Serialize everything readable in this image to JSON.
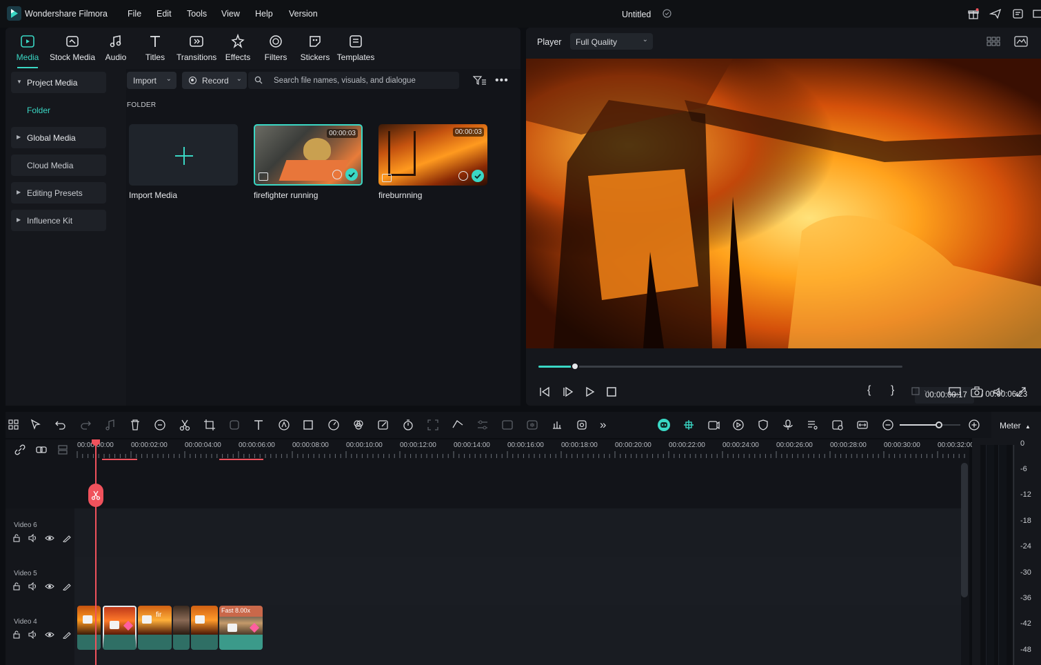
{
  "titlebar": {
    "app_name": "Wondershare Filmora",
    "menu": [
      "File",
      "Edit",
      "Tools",
      "View",
      "Help",
      "Version"
    ],
    "doc_title": "Untitled"
  },
  "media_tabs": [
    {
      "label": "Media",
      "icon": "media-icon",
      "active": true
    },
    {
      "label": "Stock Media",
      "icon": "stock-media-icon"
    },
    {
      "label": "Audio",
      "icon": "audio-icon"
    },
    {
      "label": "Titles",
      "icon": "titles-icon"
    },
    {
      "label": "Transitions",
      "icon": "transitions-icon"
    },
    {
      "label": "Effects",
      "icon": "effects-icon"
    },
    {
      "label": "Filters",
      "icon": "filters-icon"
    },
    {
      "label": "Stickers",
      "icon": "stickers-icon"
    },
    {
      "label": "Templates",
      "icon": "templates-icon"
    }
  ],
  "sidebar": {
    "project_media": "Project Media",
    "folder": "Folder",
    "global_media": "Global Media",
    "cloud_media": "Cloud Media",
    "editing_presets": "Editing Presets",
    "influence_kit": "Influence Kit"
  },
  "media_toolbar": {
    "import_label": "Import",
    "record_label": "Record",
    "search_placeholder": "Search file names, visuals, and dialogue"
  },
  "folder_label": "FOLDER",
  "media_items": [
    {
      "name": "Import Media"
    },
    {
      "name": "firefighter running",
      "duration": "00:00:03",
      "selected": true
    },
    {
      "name": "fireburnning",
      "duration": "00:00:03"
    }
  ],
  "player": {
    "label": "Player",
    "quality": "Full Quality",
    "progress": 0.1,
    "current_time": "00:00:00:17",
    "total_time": "/ 00:00:06:23"
  },
  "timeline": {
    "meter_label": "Meter",
    "zoom_level": 0.65,
    "ruler_labels": [
      "00:00:00:00",
      "00:00:02:00",
      "00:00:04:00",
      "00:00:06:00",
      "00:00:08:00",
      "00:00:10:00",
      "00:00:12:00",
      "00:00:14:00",
      "00:00:16:00",
      "00:00:18:00",
      "00:00:20:00",
      "00:00:22:00",
      "00:00:24:00",
      "00:00:26:00",
      "00:00:28:00",
      "00:00:30:00",
      "00:00:32:00"
    ],
    "tracks": [
      {
        "name": "Video 6"
      },
      {
        "name": "Video 5"
      },
      {
        "name": "Video 4"
      }
    ],
    "clip_speed_label": "Fast 8.00x",
    "clip_partial_label": "fir",
    "meter_scale": [
      "0",
      "-6",
      "-12",
      "-18",
      "-24",
      "-30",
      "-36",
      "-42",
      "-48"
    ]
  },
  "colors": {
    "accent": "#3ad8c5",
    "playhead": "#f0525c",
    "background": "#0c0e12",
    "panel": "#15171c"
  }
}
